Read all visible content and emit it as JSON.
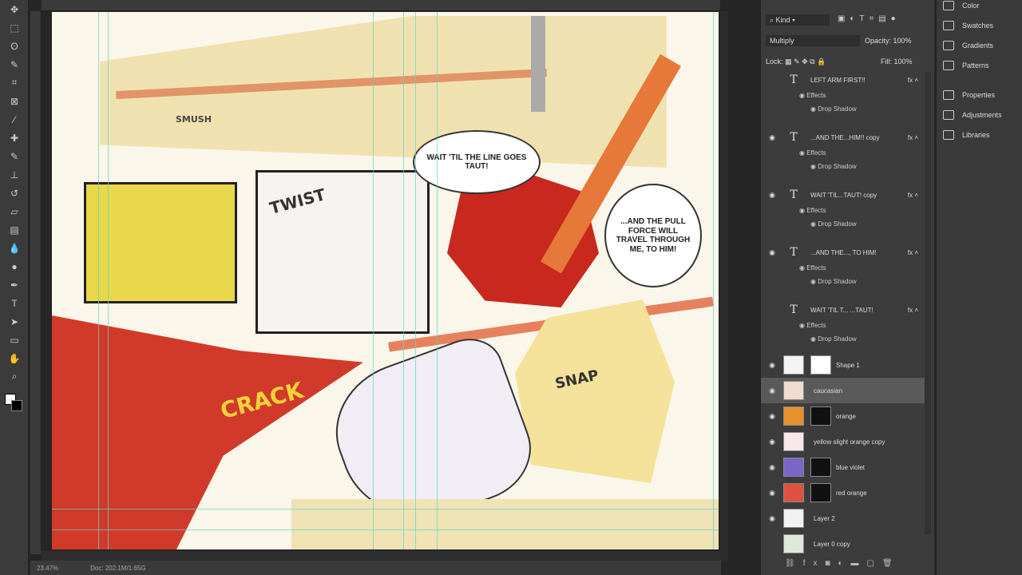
{
  "toolbar": {
    "tools": [
      "move",
      "marquee",
      "lasso",
      "quick-select",
      "crop",
      "frame",
      "eyedropper",
      "healing",
      "brush",
      "stamp",
      "history-brush",
      "eraser",
      "gradient",
      "blur",
      "dodge",
      "pen",
      "type",
      "path-select",
      "shape",
      "hand",
      "zoom"
    ]
  },
  "comic": {
    "sfx_smush": "SMUSH",
    "sfx_twist": "TWIST",
    "bubble1": "WAIT 'TIL THE LINE GOES TAUT!",
    "bubble2": "...AND THE PULL FORCE WILL TRAVEL THROUGH ME, TO HIM!",
    "sfx_crack": "CRACK",
    "sfx_snap": "SNAP"
  },
  "status": {
    "zoom": "23.47%",
    "doc": "Doc: 202.1M/1.65G"
  },
  "layers": {
    "filter": "Kind",
    "blend_mode": "Multiply",
    "opacity_label": "Opacity:",
    "opacity": "100%",
    "lock_label": "Lock:",
    "fill_label": "Fill:",
    "fill": "100%",
    "text_layers": [
      {
        "name": "LEFT ARM FIRST!!",
        "visible": false
      },
      {
        "name": "...AND THE...HIM!! copy",
        "visible": true
      },
      {
        "name": "WAIT 'TIL...TAUT! copy",
        "visible": true
      },
      {
        "name": "...AND THE..., TO HIM!",
        "visible": true
      },
      {
        "name": "WAIT 'TIL T... ...TAUT!",
        "visible": false
      }
    ],
    "effects_label": "Effects",
    "drop_shadow_label": "Drop Shadow",
    "pixel_layers": [
      {
        "name": "Shape 1",
        "color": "#f4f4f4",
        "mask": true,
        "mask_color": "#fff"
      },
      {
        "name": "caucasian",
        "color": "#f0dcd0",
        "selected": true
      },
      {
        "name": "orange",
        "color": "#e8902c",
        "mask": true
      },
      {
        "name": "yellow slight orange copy",
        "color": "#f6e8ea"
      },
      {
        "name": "blue violet",
        "color": "#7a66c8",
        "mask": true
      },
      {
        "name": "red orange",
        "color": "#e05040",
        "mask": true
      },
      {
        "name": "Layer 2",
        "color": "#f2f2f2"
      },
      {
        "name": "Layer 0 copy",
        "color": "#dfe8d8",
        "visible": false
      }
    ]
  },
  "right_panel": {
    "items": [
      "Color",
      "Swatches",
      "Gradients",
      "Patterns",
      "Properties",
      "Adjustments",
      "Libraries"
    ]
  }
}
